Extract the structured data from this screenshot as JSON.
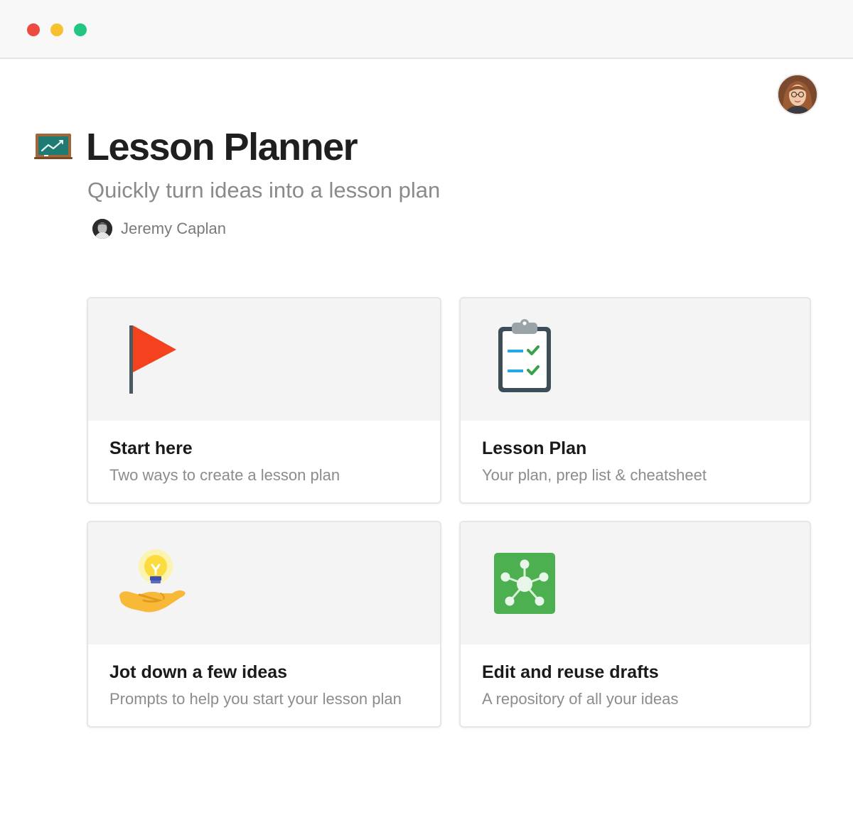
{
  "window": {
    "controls": {
      "close_color": "#ee4a3f",
      "minimize_color": "#f6c12d",
      "maximize_color": "#21c780"
    }
  },
  "user": {
    "avatar_icon": "user-avatar-icon"
  },
  "page": {
    "icon": "school-chalkboard-icon",
    "title": "Lesson Planner",
    "subtitle": "Quickly turn ideas into a lesson plan",
    "author": {
      "name": "Jeremy Caplan",
      "avatar_icon": "author-avatar-icon"
    }
  },
  "cards": [
    {
      "icon": "red-flag-icon",
      "title": "Start here",
      "description": "Two ways to create a lesson plan"
    },
    {
      "icon": "clipboard-checklist-icon",
      "title": "Lesson Plan",
      "description": "Your plan, prep list & cheatsheet"
    },
    {
      "icon": "lightbulb-hand-icon",
      "title": "Jot down a few ideas",
      "description": "Prompts to help you start your lesson plan"
    },
    {
      "icon": "network-hub-icon",
      "title": "Edit and reuse drafts",
      "description": "A repository of all your ideas"
    }
  ],
  "colors": {
    "title_text": "#1f1f1f",
    "muted_text": "#8a8a8a",
    "card_border": "#e6e6e6",
    "card_cover": "#f4f4f4",
    "flag_red": "#f4411e",
    "check_green": "#3aa04a",
    "network_green": "#4caf50"
  }
}
